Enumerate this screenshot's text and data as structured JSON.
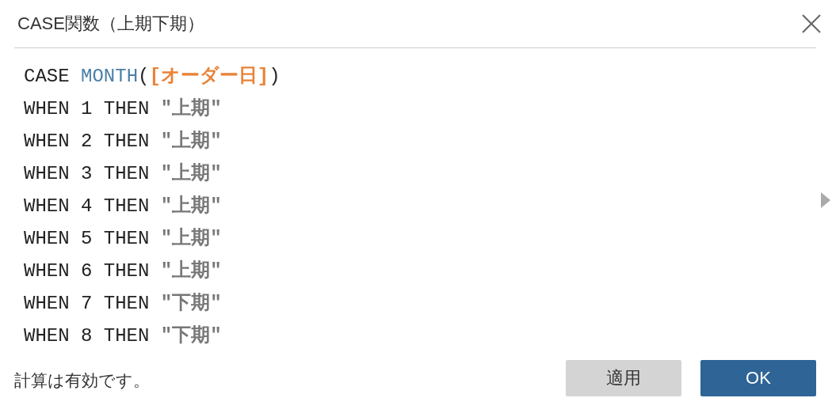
{
  "window": {
    "title": "CASE関数（上期下期）"
  },
  "code_lines": [
    [
      {
        "kind": "keyword",
        "text": "CASE "
      },
      {
        "kind": "function",
        "text": "MONTH"
      },
      {
        "kind": "plain",
        "text": "("
      },
      {
        "kind": "field",
        "text": "[オーダー日]"
      },
      {
        "kind": "plain",
        "text": ")"
      }
    ],
    [
      {
        "kind": "keyword",
        "text": "WHEN 1 THEN "
      },
      {
        "kind": "string",
        "text": "\"上期\""
      }
    ],
    [
      {
        "kind": "keyword",
        "text": "WHEN 2 THEN "
      },
      {
        "kind": "string",
        "text": "\"上期\""
      }
    ],
    [
      {
        "kind": "keyword",
        "text": "WHEN 3 THEN "
      },
      {
        "kind": "string",
        "text": "\"上期\""
      }
    ],
    [
      {
        "kind": "keyword",
        "text": "WHEN 4 THEN "
      },
      {
        "kind": "string",
        "text": "\"上期\""
      }
    ],
    [
      {
        "kind": "keyword",
        "text": "WHEN 5 THEN "
      },
      {
        "kind": "string",
        "text": "\"上期\""
      }
    ],
    [
      {
        "kind": "keyword",
        "text": "WHEN 6 THEN "
      },
      {
        "kind": "string",
        "text": "\"上期\""
      }
    ],
    [
      {
        "kind": "keyword",
        "text": "WHEN 7 THEN "
      },
      {
        "kind": "string",
        "text": "\"下期\""
      }
    ],
    [
      {
        "kind": "keyword",
        "text": "WHEN 8 THEN "
      },
      {
        "kind": "string",
        "text": "\"下期\""
      }
    ]
  ],
  "status": "計算は有効です。",
  "buttons": [
    {
      "label": "適用",
      "kind": "secondary"
    },
    {
      "label": "OK",
      "kind": "primary"
    }
  ]
}
